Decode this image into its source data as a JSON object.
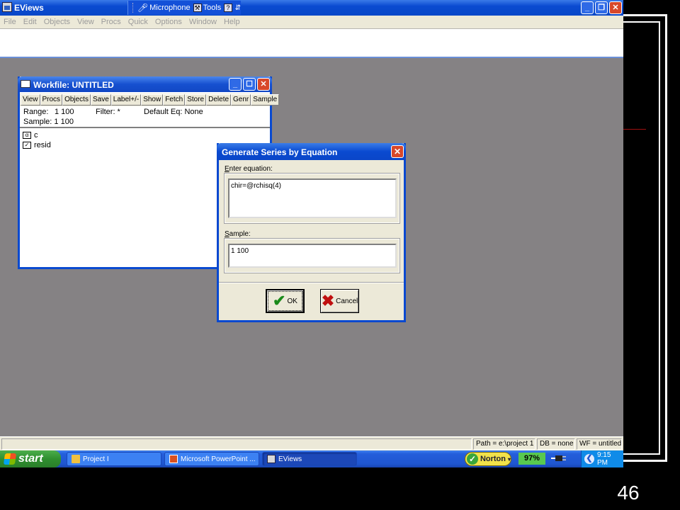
{
  "app": {
    "title": "EViews",
    "language_bar": {
      "microphone": "Microphone",
      "tools": "Tools",
      "help_glyph": "?"
    },
    "menu": [
      "File",
      "Edit",
      "Objects",
      "View",
      "Procs",
      "Quick",
      "Options",
      "Window",
      "Help"
    ]
  },
  "workfile": {
    "title": "Workfile: UNTITLED",
    "toolbar": [
      "View",
      "Procs",
      "Objects",
      "Save",
      "Label+/-",
      "Show",
      "Fetch",
      "Store",
      "Delete",
      "Genr",
      "Sample"
    ],
    "range_label": "Range:",
    "range_value": "1 100",
    "filter_label": "Filter: *",
    "default_eq": "Default Eq: None",
    "sample_label": "Sample: 1 100",
    "objects": [
      {
        "name": "c",
        "icon": "coefficient-icon"
      },
      {
        "name": "resid",
        "icon": "series-icon"
      }
    ]
  },
  "dialog": {
    "title": "Generate Series by Equation",
    "equation_label_u": "E",
    "equation_label_rest": "nter equation:",
    "equation_value": "chir=@rchisq(4)",
    "sample_label_u": "S",
    "sample_label_rest": "ample:",
    "sample_value": "1 100",
    "ok_label": "OK",
    "cancel_label": "Cancel"
  },
  "statusbar": {
    "path": "Path = e:\\project 1",
    "db": "DB = none",
    "wf": "WF = untitled"
  },
  "taskbar": {
    "start": "start",
    "items": [
      "Project I",
      "Microsoft PowerPoint ...",
      "EViews"
    ],
    "norton": "Norton",
    "battery": "97%",
    "clock": "9:15 PM"
  },
  "slide_number": "46",
  "colors": {
    "xp_blue": "#0a4ad0",
    "workspace_gray": "#858284",
    "dialog_face": "#ece9d8",
    "start_green": "#2f8f2f"
  }
}
